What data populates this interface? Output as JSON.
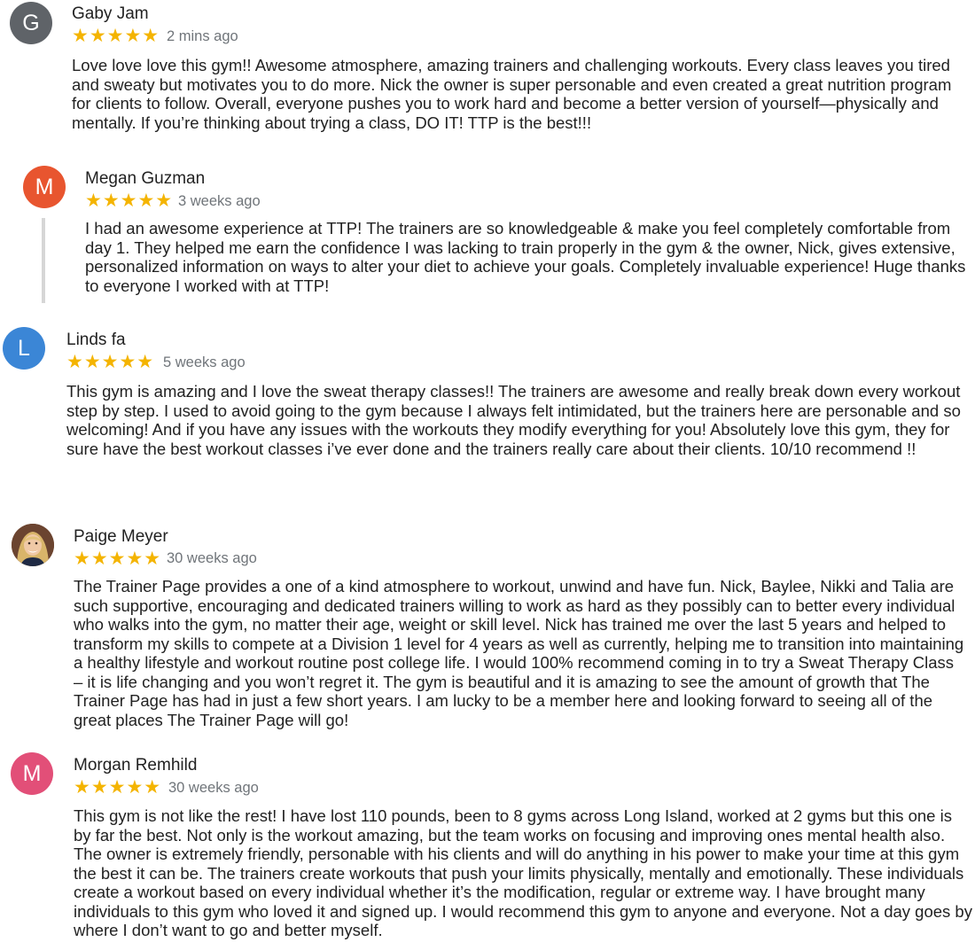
{
  "colors": {
    "star": "#f4b400",
    "avatar_g": "#5f6368",
    "avatar_m1": "#e8552f",
    "avatar_l": "#3b86d6",
    "avatar_m2": "#e24f78"
  },
  "reviews": [
    {
      "initial": "G",
      "name": "Gaby Jam",
      "stars": "★★★★★",
      "rating": 5,
      "age": "2 mins ago",
      "text": "Love love love this gym!! Awesome atmosphere, amazing trainers and challenging workouts. Every class leaves you tired and sweaty but motivates you to do more. Nick the owner is super personable and even created a great nutrition program for clients to follow. Overall, everyone pushes you to work hard and become a better version of yourself—physically and mentally. If you’re thinking about trying a class, DO IT! TTP is the best!!!"
    },
    {
      "initial": "M",
      "name": "Megan Guzman",
      "stars": "★★★★★",
      "rating": 5,
      "age": "3 weeks ago",
      "text": "I had an awesome experience at TTP! The trainers are so knowledgeable & make you feel completely comfortable from day 1. They helped me earn the confidence I was lacking to train properly in the gym & the owner, Nick, gives extensive, personalized information on ways to alter your diet to achieve your goals. Completely invaluable experience! Huge thanks to everyone I worked with at TTP!"
    },
    {
      "initial": "L",
      "name": "Linds fa",
      "stars": "★★★★★",
      "rating": 5,
      "age": "5 weeks ago",
      "text": "This gym is amazing and I love the sweat therapy classes!! The trainers are awesome and really break down every workout step by step. I used to avoid going to the gym because I always felt intimidated, but the trainers here are personable and so welcoming! And if you have any issues with the workouts they modify everything for you! Absolutely love this gym, they for sure have the best workout classes i’ve ever done and the trainers really care about their clients. 10/10 recommend !!"
    },
    {
      "initial": "",
      "name": "Paige Meyer",
      "stars": "★★★★★",
      "rating": 5,
      "age": "30 weeks ago",
      "text": "The Trainer Page provides a one of a kind atmosphere to workout, unwind and have fun. Nick, Baylee, Nikki and Talia are such supportive, encouraging and dedicated trainers willing to work as hard as they possibly can to better every individual who walks into the gym, no matter their age, weight or skill level. Nick has trained me over the last 5 years and helped to transform my skills to compete at a Division 1 level for 4 years as well as currently, helping me to transition into maintaining a healthy lifestyle and workout routine post college life. I would 100% recommend coming in to try a Sweat Therapy Class – it is life changing and you won’t regret it. The gym is beautiful and it is amazing to see the amount of growth that The Trainer Page has had in just a few short years. I am lucky to be a member here and looking forward to seeing all of the great places The Trainer Page will go!"
    },
    {
      "initial": "M",
      "name": "Morgan Remhild",
      "stars": "★★★★★",
      "rating": 5,
      "age": "30 weeks ago",
      "text": "This gym is not like the rest! I have lost 110 pounds, been to 8 gyms across Long Island, worked at 2 gyms but this one is by far the best. Not only is the workout amazing, but the team works on focusing and improving ones mental health also. The owner is extremely friendly, personable with his clients and will do anything in his power to make your time at this gym the best it can be. The trainers create workouts that push your limits physically, mentally and emotionally. These individuals create a workout based on every individual whether it’s the modification, regular or extreme way. I have brought many individuals to this gym who loved it and signed up. I would recommend this gym to anyone and everyone. Not a day goes by where I don’t want to go and better myself."
    }
  ]
}
